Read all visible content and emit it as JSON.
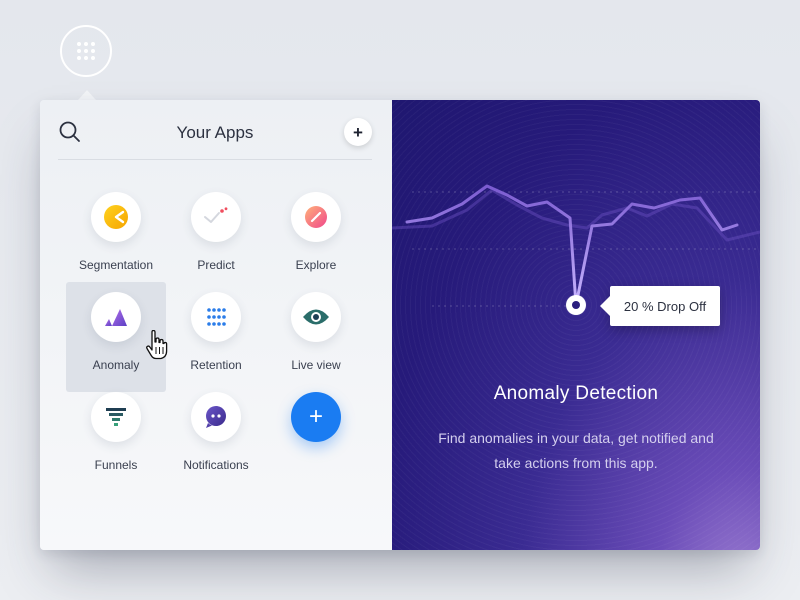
{
  "launcher": {
    "icon": "grid-dots-icon"
  },
  "header": {
    "title": "Your Apps",
    "search_icon": "search-icon",
    "add_label": "+"
  },
  "apps": [
    {
      "label": "Segmentation",
      "icon": "segmentation-icon"
    },
    {
      "label": "Predict",
      "icon": "predict-icon"
    },
    {
      "label": "Explore",
      "icon": "explore-icon"
    },
    {
      "label": "Anomaly",
      "icon": "anomaly-icon",
      "active": true
    },
    {
      "label": "Retention",
      "icon": "retention-icon"
    },
    {
      "label": "Live view",
      "icon": "live-view-icon"
    },
    {
      "label": "Funnels",
      "icon": "funnels-icon"
    },
    {
      "label": "Notifications",
      "icon": "notifications-icon"
    },
    {
      "label": "+",
      "icon": "add-app-icon"
    }
  ],
  "detail": {
    "tooltip": "20 % Drop Off",
    "title": "Anomaly Detection",
    "description": "Find anomalies in your data, get notified and take actions from this app."
  },
  "colors": {
    "accent_blue": "#1a7cf2",
    "panel_dark": "#261a7a",
    "panel_light": "#9d7ed2",
    "line": "#8f6fd6"
  }
}
